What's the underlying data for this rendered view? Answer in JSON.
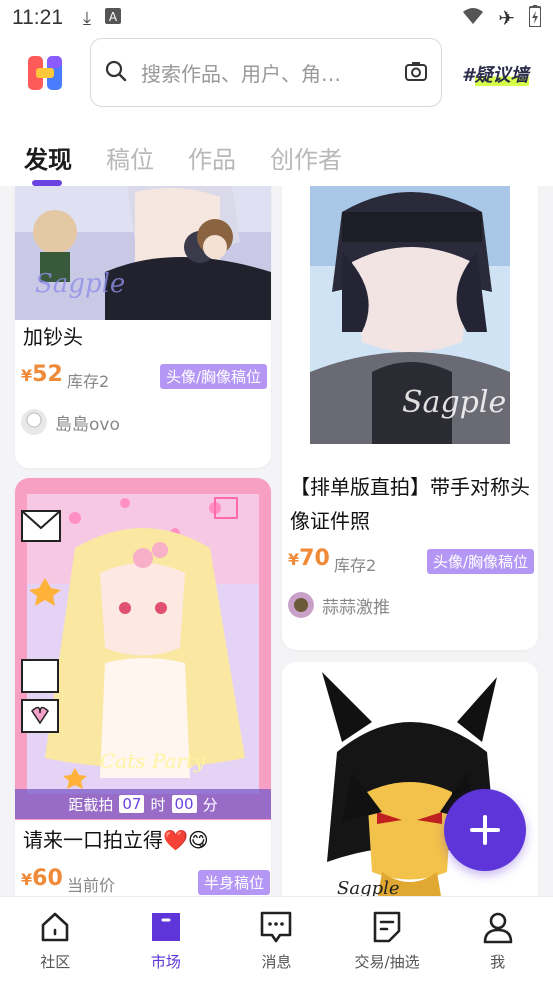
{
  "status": {
    "time": "11:21"
  },
  "search": {
    "placeholder": "搜索作品、用户、角…"
  },
  "brand": {
    "hash": "#",
    "name": "疑议墙"
  },
  "tabs": [
    {
      "label": "发现"
    },
    {
      "label": "稿位"
    },
    {
      "label": "作品"
    },
    {
      "label": "创作者"
    }
  ],
  "cards": [
    {
      "title": "加钞头",
      "currency": "¥",
      "price": "52",
      "stock": "库存2",
      "badge": "头像/胸像稿位",
      "author": "島島ovo"
    },
    {
      "title": "【排单版直拍】带手对称头像证件照",
      "currency": "¥",
      "price": "70",
      "stock": "库存2",
      "badge": "头像/胸像稿位",
      "author": "蒜蒜激推"
    },
    {
      "title": "请来一口拍立得❤️😋",
      "currency": "¥",
      "price": "60",
      "stock": "当前价",
      "badge": "半身稿位",
      "countdown": {
        "prefix": "距截拍",
        "hours": "07",
        "hour_unit": "时",
        "minutes": "00",
        "minute_unit": "分"
      },
      "watermark": "Cats Party"
    },
    {
      "title": "",
      "watermark": "Sagple"
    }
  ],
  "nav": [
    {
      "label": "社区"
    },
    {
      "label": "市场"
    },
    {
      "label": "消息"
    },
    {
      "label": "交易/抽选"
    },
    {
      "label": "我"
    }
  ],
  "colors": {
    "accent": "#5d35d8",
    "price": "#ef8a38",
    "badge": "#b497f5"
  }
}
